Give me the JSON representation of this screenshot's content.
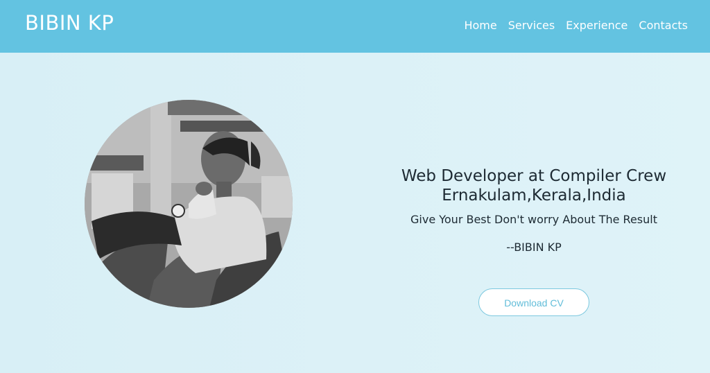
{
  "header": {
    "brand": "BIBIN KP",
    "nav": [
      {
        "label": "Home"
      },
      {
        "label": "Services"
      },
      {
        "label": "Experience"
      },
      {
        "label": "Contacts"
      }
    ]
  },
  "hero": {
    "headline_line1": "Web Developer at Compiler Crew",
    "headline_line2": "Ernakulam,Kerala,India",
    "tagline": "Give Your Best Don't worry About The Result",
    "signature": "--BIBIN KP",
    "cv_button_label": "Download CV"
  },
  "colors": {
    "navbar": "#63c3e1",
    "background": "#dbf1f7",
    "button_text": "#62bdd9"
  }
}
